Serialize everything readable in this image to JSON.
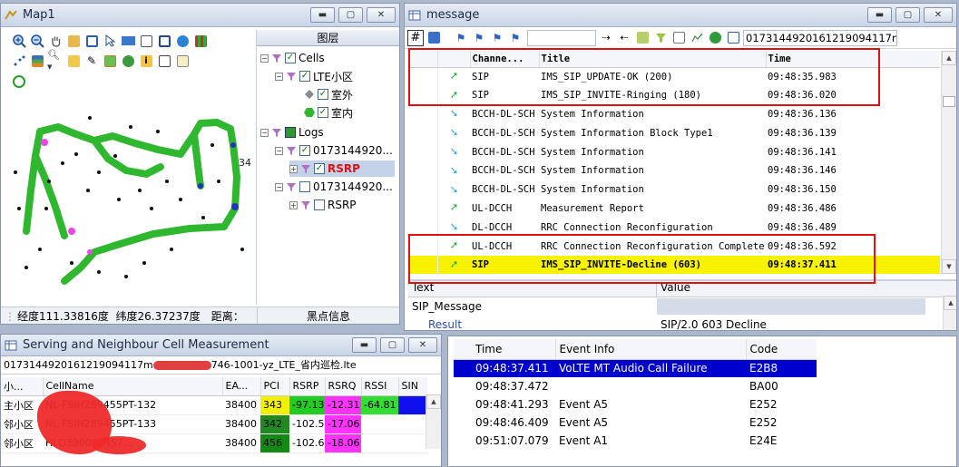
{
  "map": {
    "title": "Map1",
    "layer_header": "图层",
    "layers": {
      "cells": "Cells",
      "lte_cell": "LTE小区",
      "outdoor": "室外",
      "indoor": "室内",
      "logs": "Logs",
      "log1": "0173144920...",
      "rsrp1": "RSRP",
      "log2": "0173144920...",
      "rsrp2": "RSRP"
    },
    "label_34": "34",
    "status_coords": "经度111.33816度  纬度26.37237度",
    "status_distance": "距离：",
    "blackpoint_tab": "黑点信息"
  },
  "message": {
    "title": "message",
    "search_value": "0173144920161219094117ms",
    "columns": [
      "Channe...",
      "Title",
      "Time"
    ],
    "rows": [
      {
        "channel": "SIP",
        "title": "IMS_SIP_UPDATE-OK (200)",
        "time": "09:48:35.983",
        "arrow": "up"
      },
      {
        "channel": "SIP",
        "title": "IMS_SIP_INVITE-Ringing (180)",
        "time": "09:48:36.020",
        "arrow": "up"
      },
      {
        "channel": "BCCH-DL-SCH",
        "title": "System Information",
        "time": "09:48:36.136",
        "arrow": "down"
      },
      {
        "channel": "BCCH-DL-SCH",
        "title": "System Information Block Type1",
        "time": "09:48:36.139",
        "arrow": "down"
      },
      {
        "channel": "BCCH-DL-SCH",
        "title": "System Information",
        "time": "09:48:36.141",
        "arrow": "down"
      },
      {
        "channel": "BCCH-DL-SCH",
        "title": "System Information",
        "time": "09:48:36.146",
        "arrow": "down"
      },
      {
        "channel": "BCCH-DL-SCH",
        "title": "System Information",
        "time": "09:48:36.150",
        "arrow": "down"
      },
      {
        "channel": "UL-DCCH",
        "title": "Measurement Report",
        "time": "09:48:36.486",
        "arrow": "up"
      },
      {
        "channel": "DL-DCCH",
        "title": "RRC Connection Reconfiguration",
        "time": "09:48:36.489",
        "arrow": "down"
      },
      {
        "channel": "UL-DCCH",
        "title": "RRC Connection Reconfiguration Complete",
        "time": "09:48:36.592",
        "arrow": "up"
      },
      {
        "channel": "SIP",
        "title": "IMS_SIP_INVITE-Decline (603)",
        "time": "09:48:37.411",
        "arrow": "up"
      }
    ],
    "detail_columns": [
      "Text",
      "Value"
    ],
    "detail_rows": [
      {
        "text": "SIP_Message",
        "value": ""
      },
      {
        "text": "Result",
        "value": "SIP/2.0 603 Decline"
      }
    ]
  },
  "serving": {
    "title": "Serving and Neighbour Cell Measurement",
    "filename": "0173144920161219094117m",
    "filename_tail": "746-1001-yz_LTE_省内巡检.lte",
    "columns": [
      "小...",
      "CellName",
      "EA...",
      "PCI",
      "RSRP",
      "RSRQ",
      "RSSI",
      "SIN"
    ],
    "rows": [
      {
        "type": "主小区",
        "cell": "NL-FSIH289455PT-132",
        "earfcn": "38400",
        "pci": "343",
        "rsrp": "-97.13",
        "rsrq": "-12.31",
        "rssi": "-64.81",
        "sinr": ""
      },
      {
        "type": "邻小区",
        "cell": "NL-FSIH289455PT-133",
        "earfcn": "38400",
        "pci": "342",
        "rsrp": "-102.5",
        "rsrq": "-17.06",
        "rssi": "",
        "sinr": ""
      },
      {
        "type": "邻小区",
        "cell": "HLD390097457...",
        "earfcn": "38400",
        "pci": "456",
        "rsrp": "-102.69",
        "rsrq": "-18.06",
        "rssi": "",
        "sinr": ""
      }
    ]
  },
  "events": {
    "columns": [
      "Time",
      "Event Info",
      "Code"
    ],
    "rows": [
      {
        "time": "09:48:37.411",
        "info": "VoLTE MT Audio Call Failure",
        "code": "E2B8"
      },
      {
        "time": "09:48:37.472",
        "info": "",
        "code": "BA00"
      },
      {
        "time": "09:48:41.293",
        "info": "Event A5",
        "code": "E252"
      },
      {
        "time": "09:48:46.409",
        "info": "Event A5",
        "code": "E252"
      },
      {
        "time": "09:51:07.079",
        "info": "Event A1",
        "code": "E24E"
      }
    ]
  },
  "colors": {
    "selected_row": "#f7f200",
    "event_selected": "#0000cc",
    "highlight_box": "#e01010",
    "route_green": "#2fb82f",
    "pci_yellow": "#f0f000",
    "rsrp_green": "#22cc22",
    "rsrq_magenta": "#ff33ff",
    "rssi_green": "#33dd33",
    "sinr_blue": "#1010ee"
  }
}
